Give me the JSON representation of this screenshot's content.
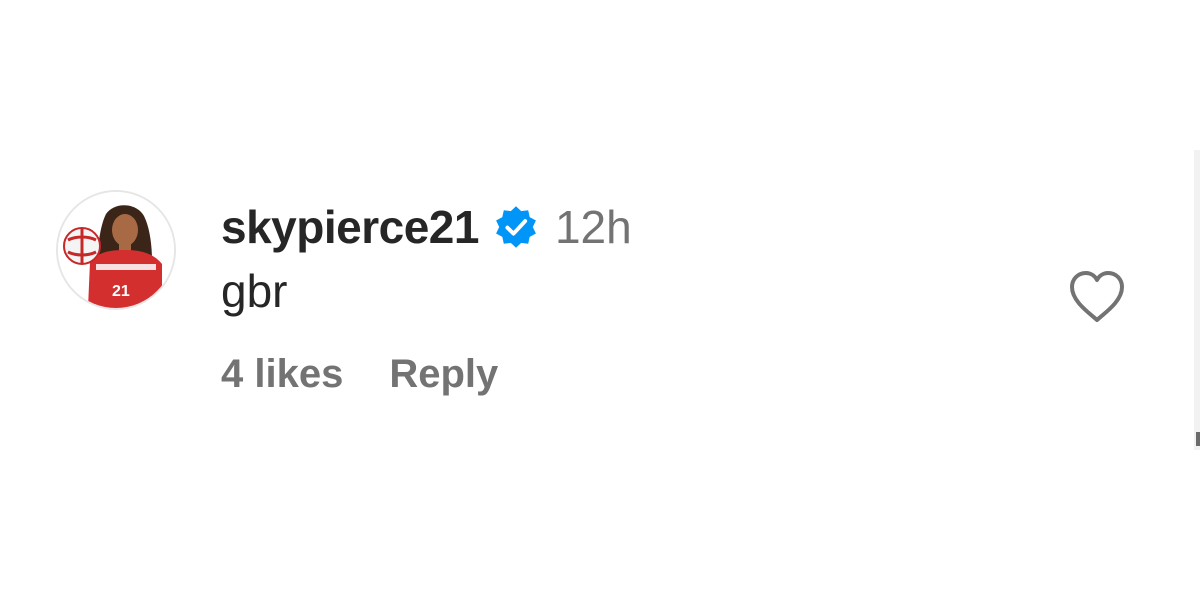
{
  "comment": {
    "username": "skypierce21",
    "verified": true,
    "timestamp": "12h",
    "text": "gbr",
    "likes_label": "4 likes",
    "reply_label": "Reply",
    "jersey_number": "21"
  },
  "icons": {
    "verified": "verified-badge-icon",
    "like": "heart-outline-icon"
  },
  "colors": {
    "verified_badge": "#0095f6",
    "username": "#262626",
    "muted": "#737373",
    "jersey": "#d32f2f"
  }
}
